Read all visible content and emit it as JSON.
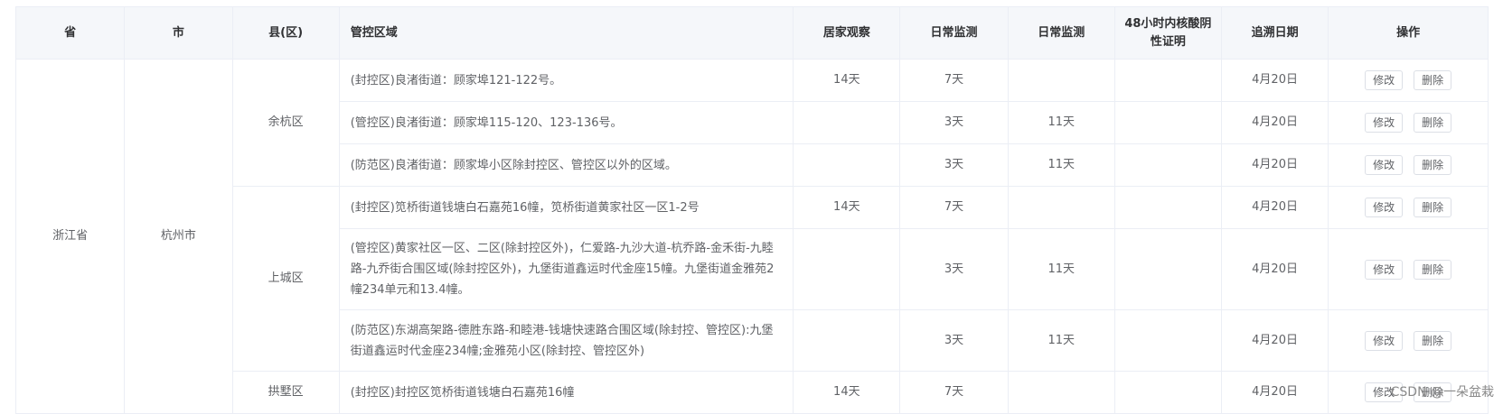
{
  "headers": {
    "province": "省",
    "city": "市",
    "county": "县(区)",
    "area": "管控区域",
    "home": "居家观察",
    "daily1": "日常监测",
    "daily2": "日常监测",
    "nucleic": "48小时内核酸阴性证明",
    "date": "追溯日期",
    "ops": "操作"
  },
  "province": "浙江省",
  "city": "杭州市",
  "counties": [
    "余杭区",
    "上城区",
    "拱墅区"
  ],
  "buttons": {
    "edit": "修改",
    "delete": "删除"
  },
  "rows": [
    {
      "area": "(封控区)良渚街道：顾家埠121-122号。",
      "home": "14天",
      "daily1": "7天",
      "daily2": "",
      "nucleic": "",
      "date": "4月20日"
    },
    {
      "area": "(管控区)良渚街道：顾家埠115-120、123-136号。",
      "home": "",
      "daily1": "3天",
      "daily2": "11天",
      "nucleic": "",
      "date": "4月20日"
    },
    {
      "area": "(防范区)良渚街道：顾家埠小区除封控区、管控区以外的区域。",
      "home": "",
      "daily1": "3天",
      "daily2": "11天",
      "nucleic": "",
      "date": "4月20日"
    },
    {
      "area": "(封控区)笕桥街道钱塘白石嘉苑16幢，笕桥街道黄家社区一区1-2号",
      "home": "14天",
      "daily1": "7天",
      "daily2": "",
      "nucleic": "",
      "date": "4月20日"
    },
    {
      "area": "(管控区)黄家社区一区、二区(除封控区外)，仁爱路-九沙大道-杭乔路-金禾街-九睦路-九乔街合围区域(除封控区外)，九堡街道鑫运时代金座15幢。九堡街道金雅苑2幢234单元和13.4幢。",
      "home": "",
      "daily1": "3天",
      "daily2": "11天",
      "nucleic": "",
      "date": "4月20日"
    },
    {
      "area": "(防范区)东湖高架路-德胜东路-和睦港-钱塘快速路合围区域(除封控、管控区):九堡街道鑫运时代金座234幢;金雅苑小区(除封控、管控区外)",
      "home": "",
      "daily1": "3天",
      "daily2": "11天",
      "nucleic": "",
      "date": "4月20日"
    },
    {
      "area": "(封控区)封控区笕桥街道钱塘白石嘉苑16幢",
      "home": "14天",
      "daily1": "7天",
      "daily2": "",
      "nucleic": "",
      "date": "4月20日"
    }
  ],
  "watermark": "CSDN @一朵盆栽"
}
